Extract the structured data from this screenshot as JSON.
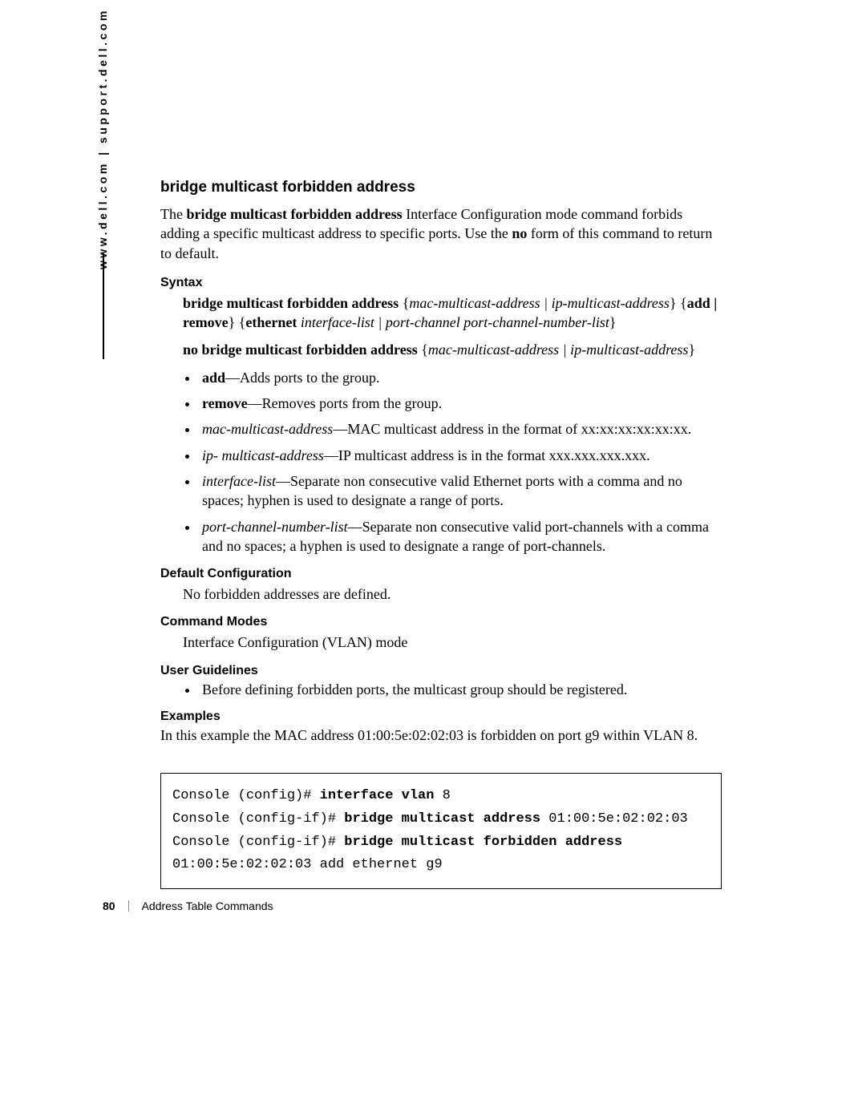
{
  "side_url": "www.dell.com | support.dell.com",
  "title": "bridge multicast forbidden address",
  "intro": {
    "pre": "The ",
    "cmd": "bridge multicast forbidden address",
    "mid": " Interface Configuration mode command forbids adding a specific multicast address to specific ports. Use the ",
    "no": "no",
    "post": " form of this command to return to default."
  },
  "syntax": {
    "heading": "Syntax",
    "line1": {
      "a": "bridge multicast forbidden address",
      "b": " {",
      "c": "mac-multicast-address | ip-multicast-address",
      "d": "} {",
      "e": "add | remove",
      "f": "} {",
      "g": "ethernet",
      "h": " ",
      "i": "interface-list | port-channel port-channel-number-list",
      "j": "}"
    },
    "line2": {
      "a": "no bridge multicast forbidden address",
      "b": " {",
      "c": "mac-multicast-address | ip-multicast-address",
      "d": "}"
    }
  },
  "params": [
    {
      "term_bold": "add",
      "desc": "—Adds ports to the group."
    },
    {
      "term_bold": "remove",
      "desc": "—Removes ports from the group."
    },
    {
      "term_italic": "mac-multicast-address",
      "desc": "—MAC multicast address in the format of xx:xx:xx:xx:xx:xx."
    },
    {
      "term_italic": "ip- multicast-address",
      "desc": "—IP multicast address is in the format xxx.xxx.xxx.xxx."
    },
    {
      "term_italic": "interface-list",
      "desc": "—Separate non consecutive valid Ethernet ports with a comma and no spaces; hyphen is used to designate a range of ports."
    },
    {
      "term_italic": "port-channel-number-list",
      "desc": "—Separate non consecutive valid port-channels with a comma and no spaces; a hyphen is used to designate a range of port-channels."
    }
  ],
  "default_cfg": {
    "heading": "Default Configuration",
    "text": "No forbidden addresses are defined."
  },
  "cmd_modes": {
    "heading": "Command Modes",
    "text": "Interface Configuration (VLAN) mode"
  },
  "guidelines": {
    "heading": "User Guidelines",
    "items": [
      "Before defining forbidden ports, the multicast group should be registered."
    ]
  },
  "examples": {
    "heading": "Examples",
    "desc": "In this example the MAC address 01:00:5e:02:02:03 is forbidden on port g9 within VLAN 8.",
    "console": {
      "l1a": "Console (config)# ",
      "l1b": "interface vlan",
      "l1c": " 8",
      "l2a": "Console (config-if)# ",
      "l2b": "bridge multicast address",
      "l2c": " 01:00:5e:02:02:03",
      "l3a": "Console (config-if)# ",
      "l3b": "bridge multicast forbidden address",
      "l3c": "",
      "l4": "01:00:5e:02:02:03 add ethernet g9"
    }
  },
  "footer": {
    "page": "80",
    "section": "Address Table Commands"
  }
}
